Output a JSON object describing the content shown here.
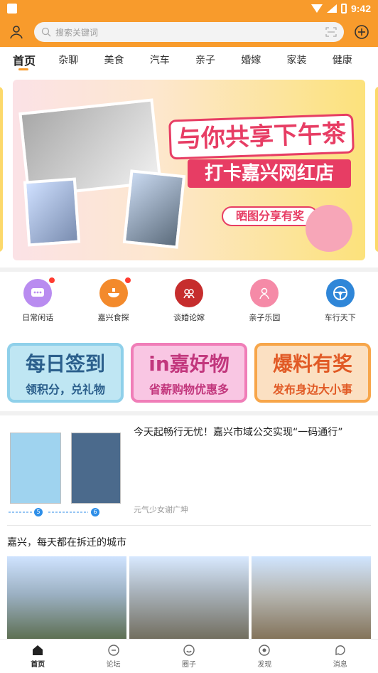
{
  "status": {
    "time": "9:42"
  },
  "header": {
    "search_placeholder": "搜索关键词"
  },
  "tabs": [
    {
      "label": "首页"
    },
    {
      "label": "杂聊"
    },
    {
      "label": "美食"
    },
    {
      "label": "汽车"
    },
    {
      "label": "亲子"
    },
    {
      "label": "婚嫁"
    },
    {
      "label": "家装"
    },
    {
      "label": "健康"
    }
  ],
  "banner": {
    "title": "与你共享下午茶",
    "subtitle": "打卡嘉兴网红店",
    "tag": "晒图分享有奖"
  },
  "shortcuts": [
    {
      "label": "日常闲话",
      "icon": "chat-bubble-icon",
      "color": "#b98cf0",
      "badge": true
    },
    {
      "label": "嘉兴食探",
      "icon": "food-icon",
      "color": "#f38a2c",
      "badge": true
    },
    {
      "label": "谈婚论嫁",
      "icon": "wedding-icon",
      "color": "#c62d2d",
      "badge": false
    },
    {
      "label": "亲子乐园",
      "icon": "parent-child-icon",
      "color": "#f58aa7",
      "badge": false
    },
    {
      "label": "车行天下",
      "icon": "steering-wheel-icon",
      "color": "#2f86d8",
      "badge": false
    }
  ],
  "promos": [
    {
      "title": "每日签到",
      "sub": "领积分，兑礼物"
    },
    {
      "title": "in嘉好物",
      "sub": "省薪购物优惠多"
    },
    {
      "title": "爆料有奖",
      "sub": "发布身边大小事"
    }
  ],
  "article": {
    "title": "今天起畅行无忧！嘉兴市域公交实现“一码通行”",
    "author": "元气少女谢广坤",
    "steps": [
      "5",
      "6"
    ]
  },
  "post": {
    "title": "嘉兴，每天都在拆迁的城市"
  },
  "tabbar": [
    {
      "label": "首页",
      "icon": "home-icon"
    },
    {
      "label": "论坛",
      "icon": "forum-icon"
    },
    {
      "label": "圈子",
      "icon": "circle-icon"
    },
    {
      "label": "发现",
      "icon": "discover-icon"
    },
    {
      "label": "消息",
      "icon": "message-icon"
    }
  ],
  "colors": {
    "accent": "#f89b2c"
  }
}
